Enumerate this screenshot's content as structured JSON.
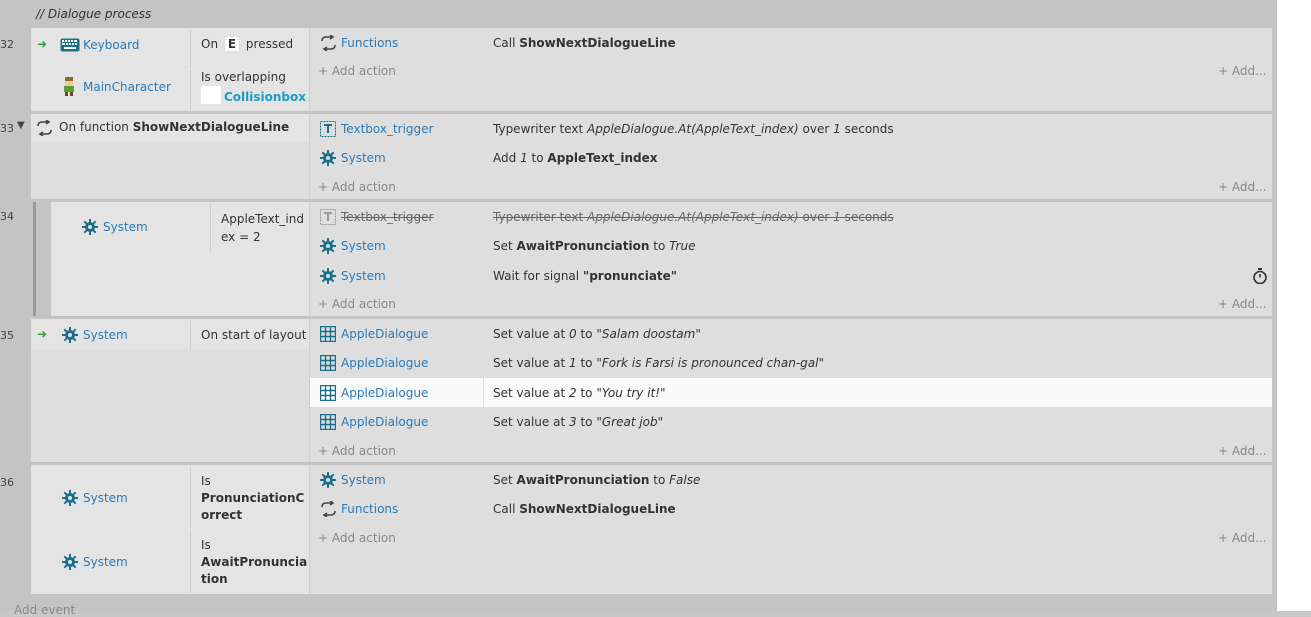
{
  "comment": "//  Dialogue process",
  "events": [
    {
      "number": "32",
      "conditions": [
        {
          "object": "Keyboard",
          "text_prefix": "On",
          "key": "E",
          "text_suffix": "pressed"
        },
        {
          "object": "MainCharacter",
          "text": "Is overlapping",
          "target": "Collisionbox"
        }
      ],
      "actions": [
        {
          "object": "Functions",
          "text_prefix": "Call",
          "text_bold": "ShowNextDialogueLine"
        }
      ]
    },
    {
      "number": "33",
      "function_label": "On function",
      "function_name": "ShowNextDialogueLine",
      "actions": [
        {
          "object": "Textbox_trigger",
          "t1": "Typewriter text",
          "t2": "AppleDialogue.At(AppleText_index)",
          "t3": "over",
          "t4": "1",
          "t5": "seconds"
        },
        {
          "object": "System",
          "t1": "Add",
          "t2": "1",
          "t3": "to",
          "t4": "AppleText_index"
        }
      ]
    },
    {
      "number": "34",
      "condition": {
        "object": "System",
        "text": "AppleText_ind ex = 2"
      },
      "actions": [
        {
          "object": "Textbox_trigger",
          "t1": "Typewriter text",
          "t2": "AppleDialogue.At(AppleText_index)",
          "t3": "over",
          "t4": "1",
          "t5": "seconds"
        },
        {
          "object": "System",
          "t1": "Set",
          "t2": "AwaitPronunciation",
          "t3": "to",
          "t4": "True"
        },
        {
          "object": "System",
          "t1": "Wait for signal",
          "t2": "\"pronunciate\""
        }
      ]
    },
    {
      "number": "35",
      "condition": {
        "object": "System",
        "text": "On start of layout"
      },
      "actions": [
        {
          "object": "AppleDialogue",
          "t1": "Set value at",
          "t2": "0",
          "t3": "to",
          "t4": "\"Salam doostam\""
        },
        {
          "object": "AppleDialogue",
          "t1": "Set value at",
          "t2": "1",
          "t3": "to",
          "t4": "\"Fork is Farsi is pronounced chan-gal\""
        },
        {
          "object": "AppleDialogue",
          "t1": "Set value at",
          "t2": "2",
          "t3": "to",
          "t4": "\"You try it!\""
        },
        {
          "object": "AppleDialogue",
          "t1": "Set value at",
          "t2": "3",
          "t3": "to",
          "t4": "\"Great job\""
        }
      ]
    },
    {
      "number": "36",
      "conditions": [
        {
          "object": "System",
          "is": "Is",
          "name_l1": "PronunciationC",
          "name_l2": "orrect"
        },
        {
          "object": "System",
          "is": "Is",
          "name_l1": "AwaitPronuncia",
          "name_l2": "tion"
        }
      ],
      "actions": [
        {
          "object": "System",
          "t1": "Set",
          "t2": "AwaitPronunciation",
          "t3": "to",
          "t4": "False"
        },
        {
          "object": "Functions",
          "t1": "Call",
          "t2": "ShowNextDialogueLine"
        }
      ]
    }
  ],
  "add_action": "+ Add action",
  "add_more": "+ Add...",
  "add_event": "Add event",
  "icons": {
    "event_arrow": "green-arrow-icon",
    "keyboard": "keyboard-icon",
    "character": "character-sprite-icon",
    "gear": "gear-icon",
    "functions": "functions-icon",
    "textbox": "textbox-icon",
    "array": "array-grid-icon",
    "timer": "stopwatch-icon",
    "collapse": "collapse-triangle-icon"
  },
  "colors": {
    "link": "#2a7ab8",
    "gear": "#1b6f8a",
    "accent": "#1f9bc2",
    "arrow": "#2fa52f"
  }
}
